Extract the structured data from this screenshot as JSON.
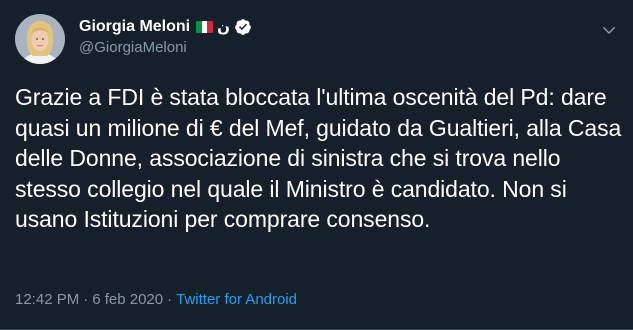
{
  "tweet": {
    "author": {
      "display_name": "Giorgia Meloni",
      "handle": "@GiorgiaMeloni",
      "emoji_text": "ن",
      "verified": true,
      "flag": "italy-flag",
      "colors": {
        "flag_green": "#009246",
        "flag_white": "#ffffff",
        "flag_red": "#ce2b37"
      }
    },
    "text": "Grazie a FDI è stata bloccata l'ultima oscenità del Pd: dare quasi un milione di € del Mef, guidato da Gualtieri, alla Casa delle Donne, associazione di sinistra che si trova nello stesso collegio nel quale il Ministro è candidato. Non si usano Istituzioni per comprare consenso.",
    "time": "12:42 PM",
    "separator": "·",
    "date": "6 feb 2020",
    "source": "Twitter for Android"
  },
  "theme": {
    "background": "#15202b",
    "text": "#ffffff",
    "secondary_text": "#8899a6",
    "accent": "#1da1f2",
    "divider": "#38444d"
  },
  "icons": {
    "menu": "chevron-down-icon",
    "verified": "verified-badge-icon"
  }
}
